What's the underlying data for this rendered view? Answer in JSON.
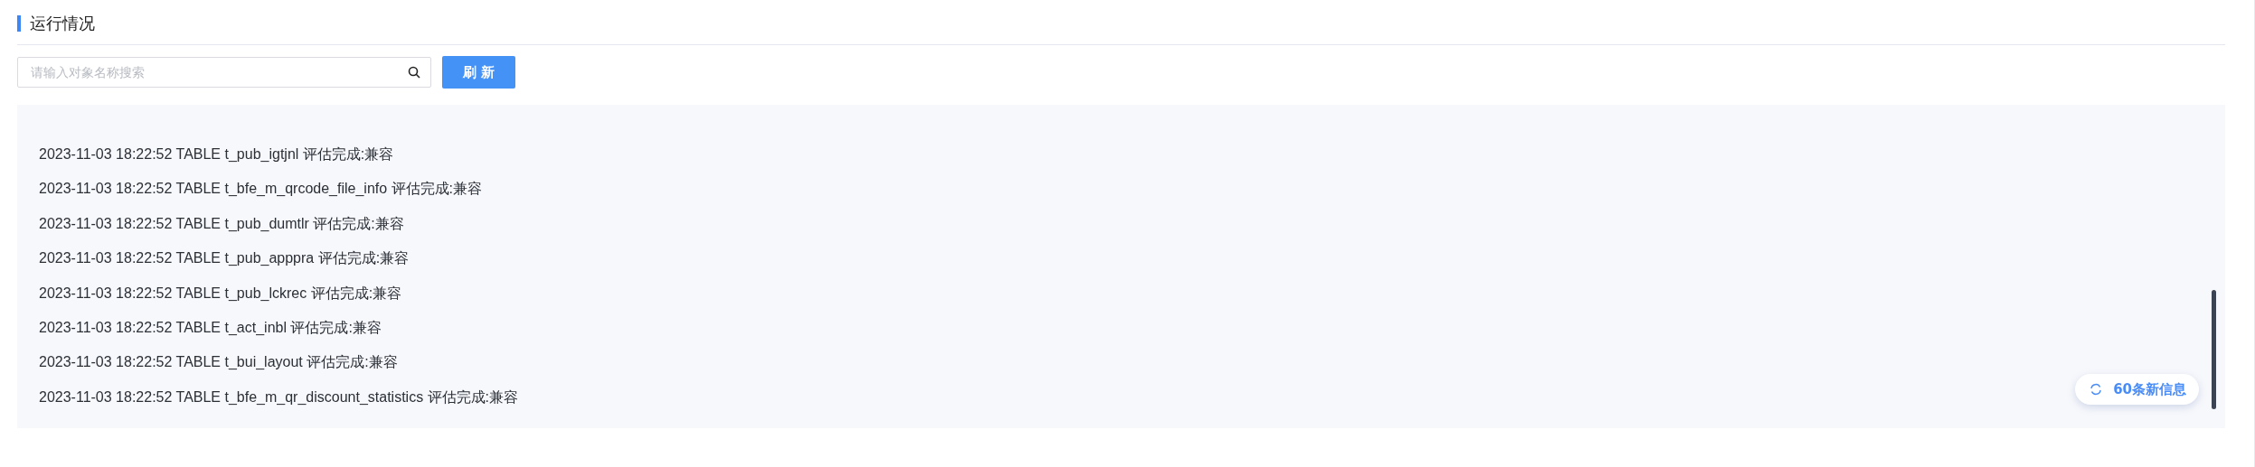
{
  "section": {
    "title": "运行情况"
  },
  "search": {
    "placeholder": "请输入对象名称搜索"
  },
  "refresh_button": {
    "label": "刷 新"
  },
  "log": {
    "lines": [
      "2023-11-03 18:22:52 TABLE t_pub_igtjnl 评估完成:兼容",
      "2023-11-03 18:22:52 TABLE t_bfe_m_qrcode_file_info 评估完成:兼容",
      "2023-11-03 18:22:52 TABLE t_pub_dumtlr 评估完成:兼容",
      "2023-11-03 18:22:52 TABLE t_pub_apppra 评估完成:兼容",
      "2023-11-03 18:22:52 TABLE t_pub_lckrec 评估完成:兼容",
      "2023-11-03 18:22:52 TABLE t_act_inbl 评估完成:兼容",
      "2023-11-03 18:22:52 TABLE t_bui_layout 评估完成:兼容",
      "2023-11-03 18:22:52 TABLE t_bfe_m_qr_discount_statistics 评估完成:兼容"
    ]
  },
  "new_messages": {
    "label": "60条新信息"
  }
}
